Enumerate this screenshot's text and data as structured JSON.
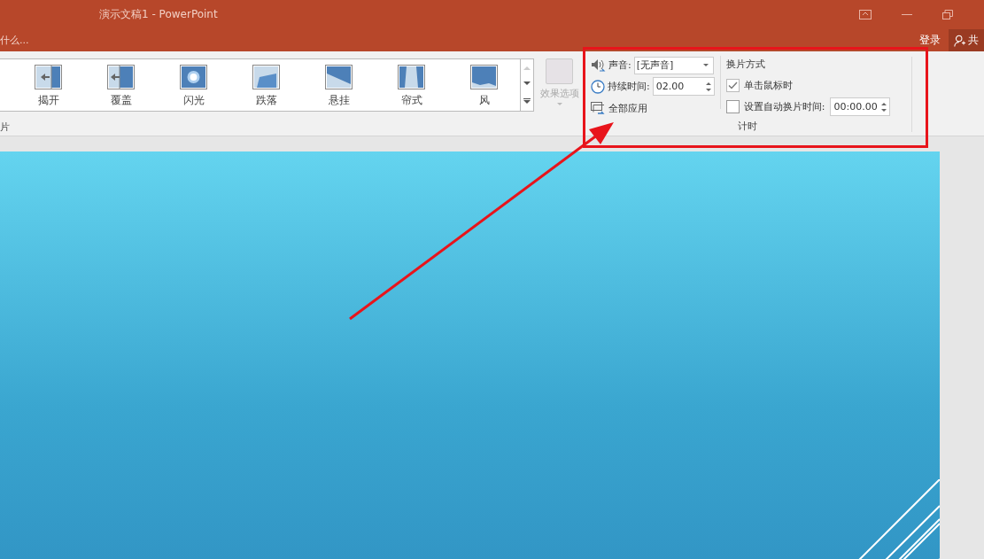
{
  "window": {
    "title": "演示文稿1 - PowerPoint"
  },
  "tell_me": {
    "placeholder": "什么..."
  },
  "account": {
    "sign_in": "登录",
    "share": "共"
  },
  "gallery": {
    "items": [
      {
        "label": "揭开",
        "kind": "uncover"
      },
      {
        "label": "覆盖",
        "kind": "cover"
      },
      {
        "label": "闪光",
        "kind": "flash"
      },
      {
        "label": "跌落",
        "kind": "fall"
      },
      {
        "label": "悬挂",
        "kind": "drape"
      },
      {
        "label": "帘式",
        "kind": "curtains"
      },
      {
        "label": "风",
        "kind": "wind"
      }
    ],
    "group_label": "片"
  },
  "effect_options": {
    "label": "效果选项",
    "disabled": true
  },
  "timing": {
    "sound_label": "声音:",
    "sound_value": "[无声音]",
    "duration_label": "持续时间:",
    "duration_value": "02.00",
    "apply_all": "全部应用",
    "advance_heading": "换片方式",
    "on_click": {
      "label": "单击鼠标时",
      "checked": true
    },
    "after": {
      "label": "设置自动换片时间:",
      "checked": false,
      "value": "00:00.00"
    },
    "group_label": "计时"
  }
}
